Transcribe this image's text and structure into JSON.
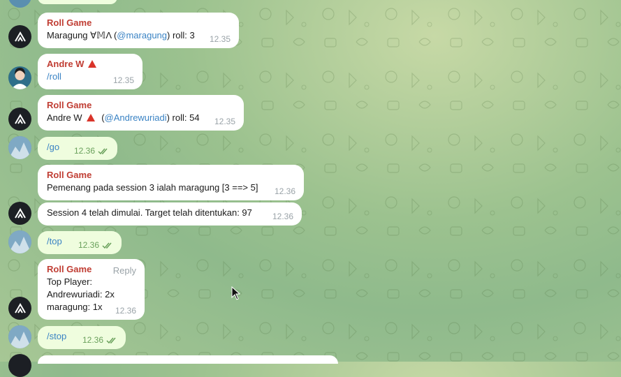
{
  "messages": {
    "m1": {
      "sender": "Roll Game",
      "text_before": "Maragung ∀𝕄Λ (",
      "mention": "@maragung",
      "text_after": ") roll: 3",
      "time": "12.35"
    },
    "m2": {
      "sender": "Andre W",
      "text": "/roll",
      "time": "12.35"
    },
    "m3": {
      "sender": "Roll Game",
      "text_name": "Andre W",
      "text_before": " (",
      "mention": "@Andrewuriadi",
      "text_after": ") roll: 54",
      "time": "12.35"
    },
    "m4": {
      "text": "/go",
      "time": "12.36"
    },
    "m5": {
      "sender": "Roll Game",
      "text": "Pemenang pada session 3 ialah maragung [3 ==> 5]",
      "time": "12.36"
    },
    "m6": {
      "text": "Session 4 telah dimulai. Target telah ditentukan: 97",
      "time": "12.36"
    },
    "m7": {
      "text": "/top",
      "time": "12.36"
    },
    "m8": {
      "sender": "Roll Game",
      "reply_label": "Reply",
      "line1": "Top Player:",
      "line2": "Andrewuriadi: 2x",
      "line3": "maragung: 1x",
      "time": "12.36"
    },
    "m9": {
      "text": "/stop",
      "time": "12.36"
    }
  },
  "colors": {
    "sender_name": "#c03d33",
    "link": "#3a83c4",
    "outgoing_bubble": "#effdde",
    "incoming_bubble": "#ffffff"
  }
}
